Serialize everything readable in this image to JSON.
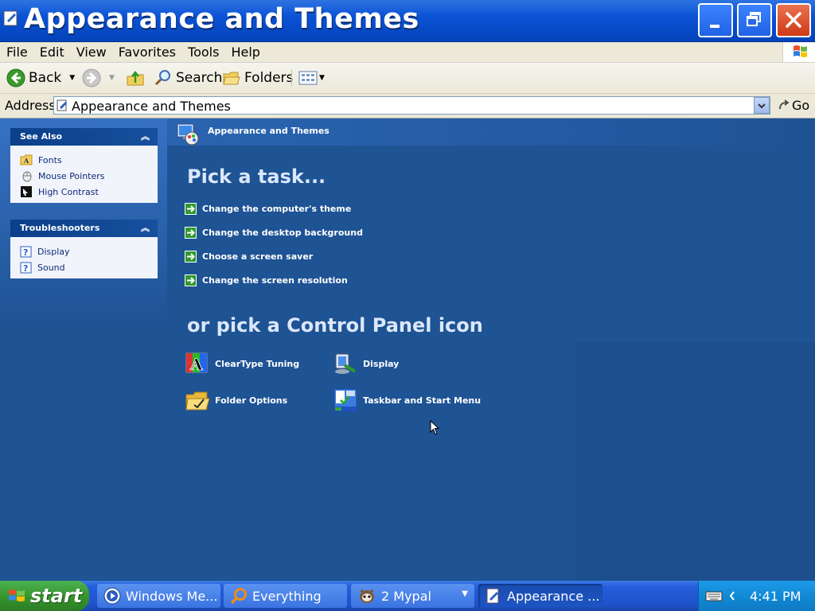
{
  "window": {
    "title": "Appearance and Themes"
  },
  "menubar": {
    "items": [
      "File",
      "Edit",
      "View",
      "Favorites",
      "Tools",
      "Help"
    ]
  },
  "toolbar": {
    "back_label": "Back",
    "search_label": "Search",
    "folders_label": "Folders"
  },
  "address": {
    "label": "Address",
    "value": "Appearance and Themes",
    "go_label": "Go"
  },
  "sidebar": {
    "see_also": {
      "title": "See Also",
      "items": [
        {
          "label": "Fonts",
          "icon": "fonts-folder-icon"
        },
        {
          "label": "Mouse Pointers",
          "icon": "mouse-icon"
        },
        {
          "label": "High Contrast",
          "icon": "high-contrast-icon"
        }
      ]
    },
    "troubleshooters": {
      "title": "Troubleshooters",
      "items": [
        {
          "label": "Display",
          "icon": "help-icon"
        },
        {
          "label": "Sound",
          "icon": "help-icon"
        }
      ]
    }
  },
  "main": {
    "breadcrumb": "Appearance and Themes",
    "task_heading": "Pick a task...",
    "tasks": [
      "Change the computer's theme",
      "Change the desktop background",
      "Choose a screen saver",
      "Change the screen resolution"
    ],
    "icon_heading": "or pick a Control Panel icon",
    "icons": [
      {
        "label": "ClearType Tuning",
        "icon": "cleartype-icon"
      },
      {
        "label": "Display",
        "icon": "display-icon"
      },
      {
        "label": "Folder Options",
        "icon": "folder-options-icon"
      },
      {
        "label": "Taskbar and Start Menu",
        "icon": "taskbar-icon"
      }
    ]
  },
  "taskbar": {
    "start_label": "start",
    "buttons": [
      {
        "label": "Windows Me...",
        "icon": "media-player-icon"
      },
      {
        "label": "Everything",
        "icon": "everything-search-icon"
      },
      {
        "label": "2 Mypal",
        "icon": "mypal-icon"
      },
      {
        "label": "Appearance ...",
        "icon": "control-panel-icon"
      }
    ],
    "clock": "4:41 PM"
  },
  "colors": {
    "title_bar": "#0a52d6",
    "content_bg": "#1e5394",
    "start_green": "#37962f",
    "tray_blue": "#128ad6",
    "close_red": "#cf3a16"
  }
}
